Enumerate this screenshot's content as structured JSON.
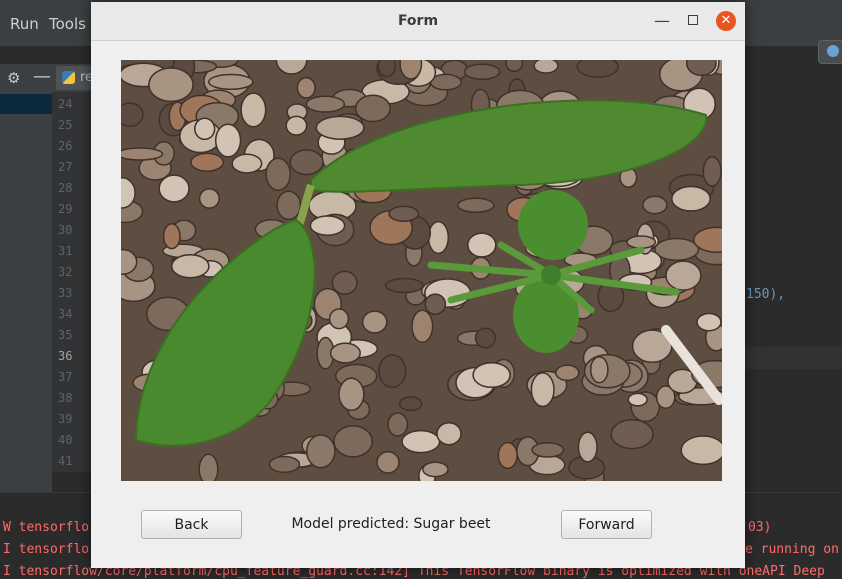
{
  "ide": {
    "menu": [
      "Run",
      "Tools"
    ],
    "file_tab": "re",
    "line_numbers": [
      "24",
      "25",
      "26",
      "27",
      "28",
      "29",
      "30",
      "31",
      "32",
      "33",
      "34",
      "35",
      "36",
      "37",
      "38",
      "39",
      "40",
      "41"
    ],
    "current_line": "36",
    "code_fragment": "150),",
    "console": {
      "lines": [
        {
          "left": "W tensorflo",
          "right": "03)"
        },
        {
          "left": "I tensorflo",
          "right": "e running on"
        },
        {
          "left": "I tensorflow/core/platform/cpu_feature_guard.cc:142] This TensorFlow binary is optimized with oneAPI Deep",
          "right": ""
        }
      ]
    }
  },
  "dialog": {
    "title": "Form",
    "image": "seedling-photo",
    "back_label": "Back",
    "prediction_text": "Model predicted: Sugar beet",
    "forward_label": "Forward",
    "close_color": "#e95420"
  }
}
